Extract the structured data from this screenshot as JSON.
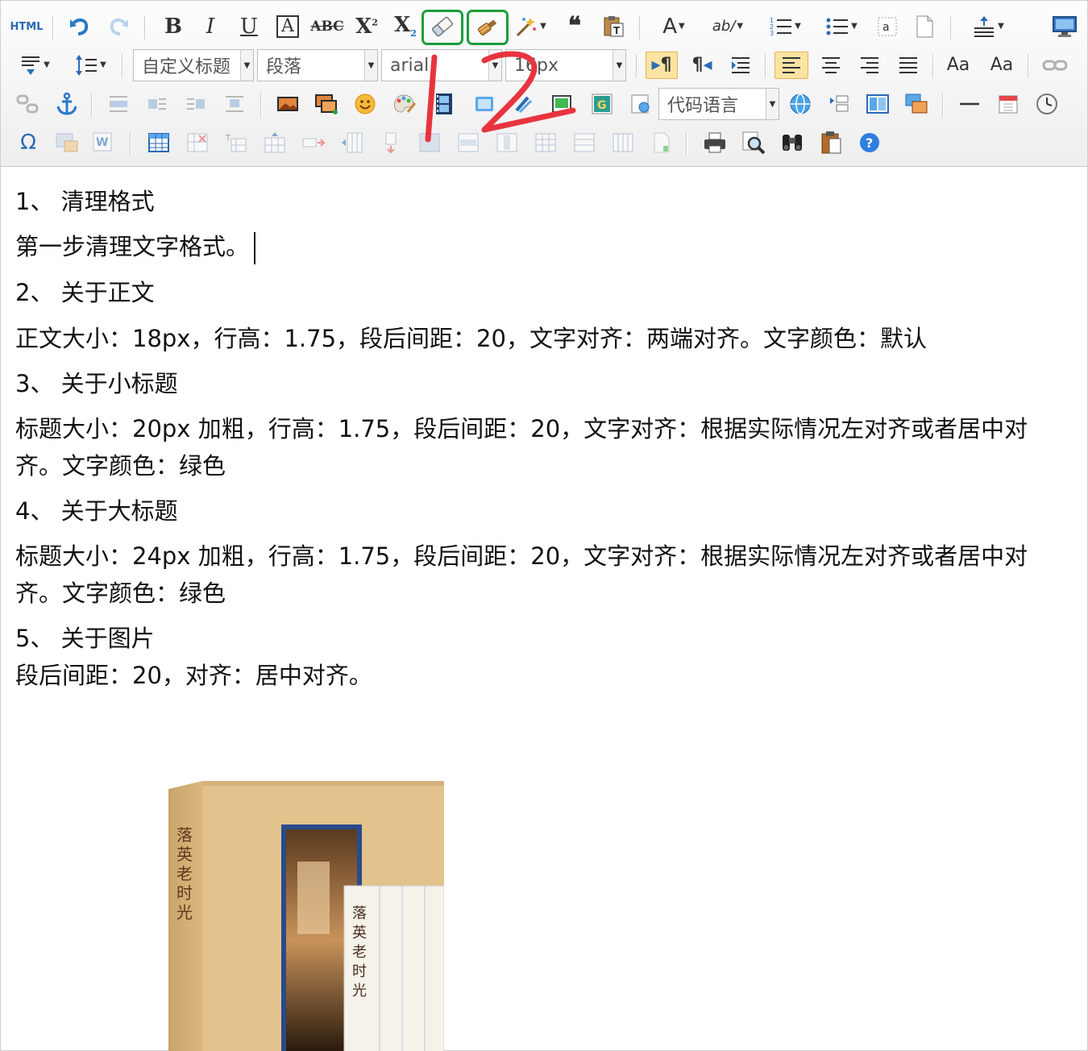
{
  "toolbar": {
    "html_label": "HTML",
    "custom_heading": "自定义标题",
    "paragraph_format": "段落",
    "font_family": "arial",
    "font_size": "16px",
    "code_language": "代码语言",
    "accent_highlight": "#1e9c3a",
    "annotation_color": "#e8343e",
    "annotation_text": "12"
  },
  "content": {
    "paragraphs": [
      "1、  清理格式",
      "第一步清理文字格式。",
      "2、  关于正文",
      "正文大小：18px，行高：1.75，段后间距：20，文字对齐：两端对齐。文字颜色：默认",
      "3、  关于小标题",
      "标题大小：20px 加粗，行高：1.75，段后间距：20，文字对齐：根据实际情况左对齐或者居中对齐。文字颜色：绿色",
      "4、  关于大标题",
      "标题大小：24px 加粗，行高：1.75，段后间距：20，文字对齐：根据实际情况左对齐或者居中对齐。文字颜色：绿色",
      "5、  关于图片",
      "段后间距：20，对齐：居中对齐。"
    ]
  },
  "book": {
    "title": "落英老时光"
  }
}
